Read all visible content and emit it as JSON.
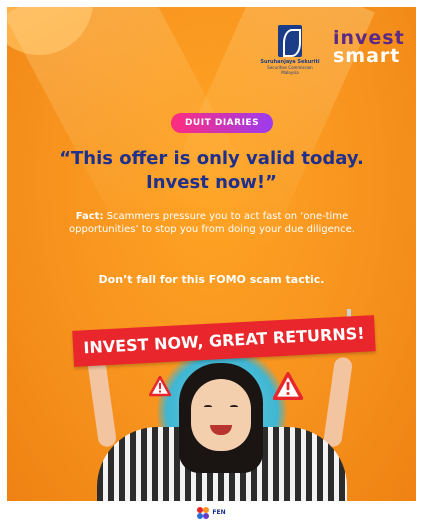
{
  "logos": {
    "sc_name": "Suruhanjaya Sekuriti",
    "sc_sub_1": "Securities Commission",
    "sc_sub_2": "Malaysia",
    "investsmart_line1": "invest",
    "investsmart_line2": "smart"
  },
  "badge": {
    "label": "DUIT DIARIES"
  },
  "headline": {
    "line1": "“This offer is only valid today.",
    "line2": "Invest now!”"
  },
  "fact": {
    "lead": "Fact:",
    "body": " Scammers pressure you to act fast on ‘one-time opportunities’ to stop you from doing your due diligence."
  },
  "tactic": {
    "text": "Don’t fall for this FOMO scam tactic."
  },
  "banner": {
    "text": "INVEST NOW, GREAT RETURNS!"
  },
  "footer": {
    "brand": "FEN"
  },
  "colors": {
    "background": "#f7931e",
    "headline": "#1e2f8c",
    "banner": "#e8262c",
    "badge_start": "#ff2d7d",
    "badge_end": "#9b3cf0"
  },
  "icons": [
    "warning-icon",
    "warning-icon"
  ]
}
